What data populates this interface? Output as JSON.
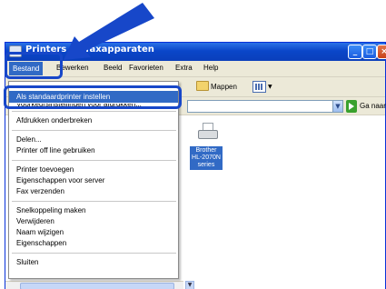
{
  "window": {
    "title": "Printers en faxapparaten"
  },
  "menubar": {
    "items": [
      "Bestand",
      "Bewerken",
      "Beeld",
      "Favorieten",
      "Extra",
      "Help"
    ]
  },
  "toolbar": {
    "folders_label": "Mappen"
  },
  "addressbar": {
    "go_label": "Ga naar"
  },
  "dropdown": {
    "selected_item": "Als standaardprinter instellen",
    "partial_item": "Voorkeursinstellingen voor afdrukken...",
    "group1": [
      "Afdrukken onderbreken"
    ],
    "group2": [
      "Delen...",
      "Printer off line gebruiken"
    ],
    "group3": [
      "Printer toevoegen",
      "Eigenschappen voor server",
      "Fax verzenden"
    ],
    "group4": [
      "Snelkoppeling maken",
      "Verwijderen",
      "Naam wijzigen",
      "Eigenschappen"
    ],
    "group5": [
      "Sluiten"
    ]
  },
  "printer": {
    "label_line1": "Brother",
    "label_line2": "HL-2070N",
    "label_line3": "series"
  },
  "colors": {
    "highlight": "#1747c9",
    "selection": "#316ac5",
    "titlebar": "#0a46c9"
  }
}
